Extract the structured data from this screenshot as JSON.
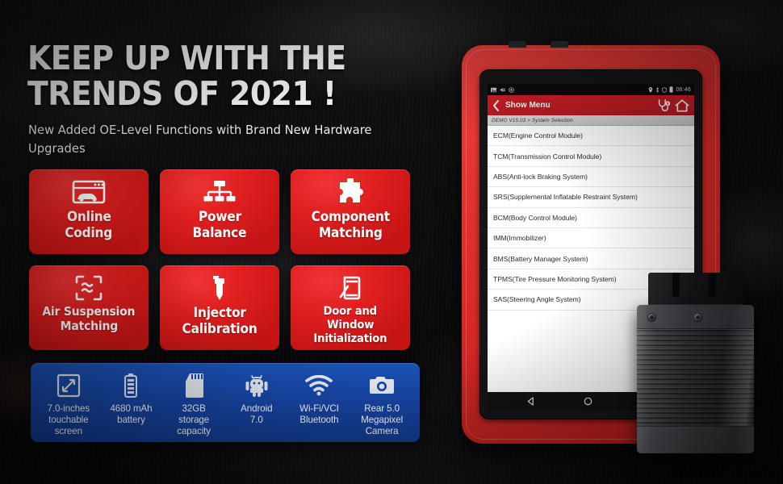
{
  "hero": {
    "headline_line1": "KEEP UP WITH THE",
    "headline_line2": "TRENDS OF 2021 !",
    "subheadline": "New Added OE-Level Functions with Brand New Hardware Upgrades"
  },
  "colors": {
    "tile_red": "#e01f1f",
    "spec_blue": "#1746a6",
    "bezel_red": "#e22a26",
    "app_header_red": "#cf2027"
  },
  "features": [
    {
      "label_line1": "Online",
      "label_line2": "Coding",
      "icon": "browser-car-icon",
      "size": "normal"
    },
    {
      "label_line1": "Power",
      "label_line2": "Balance",
      "icon": "node-tree-icon",
      "size": "normal"
    },
    {
      "label_line1": "Component",
      "label_line2": "Matching",
      "icon": "puzzle-piece-icon",
      "size": "normal"
    },
    {
      "label_line1": "Air Suspension",
      "label_line2": "Matching",
      "icon": "suspension-wave-icon",
      "size": "small"
    },
    {
      "label_line1": "Injector",
      "label_line2": "Calibration",
      "icon": "injector-icon",
      "size": "normal"
    },
    {
      "label_line1": "Door and",
      "label_line2": "Window",
      "label_line3": "Initialization",
      "icon": "door-window-icon",
      "size": "xsmall"
    }
  ],
  "specs": [
    {
      "icon": "screen-size-icon",
      "line1": "7.0-inches",
      "line2": "touchable",
      "line3": "screen"
    },
    {
      "icon": "battery-icon",
      "line1": "4680 mAh",
      "line2": "battery",
      "line3": ""
    },
    {
      "icon": "sd-card-icon",
      "line1": "32GB",
      "line2": "storage",
      "line3": "capacity"
    },
    {
      "icon": "android-icon",
      "line1": "Android",
      "line2": "7.0",
      "line3": ""
    },
    {
      "icon": "wifi-icon",
      "line1": "Wi-Fi/VCI",
      "line2": "Bluetooth",
      "line3": ""
    },
    {
      "icon": "camera-icon",
      "line1": "Rear 5.0",
      "line2": "Megapixel",
      "line3": "Camera"
    }
  ],
  "tablet": {
    "statusbar": {
      "time": "06:46",
      "left_icons": [
        "screenshot-icon",
        "mute-icon",
        "vibrate-icon"
      ],
      "right_icons": [
        "location-icon",
        "bluetooth-icon",
        "shield-icon",
        "battery-icon"
      ]
    },
    "app_header": {
      "back_icon": "chevron-left-icon",
      "title": "Show Menu",
      "right_icons": [
        "diagnostics-stethoscope-icon",
        "home-icon"
      ]
    },
    "breadcrumb": "DEMO V15.03 > System Selection",
    "system_list": [
      "ECM(Engine Control Module)",
      "TCM(Transmission Control Module)",
      "ABS(Anti-lock Braking System)",
      "SRS(Supplemental Inflatable Restraint System)",
      "BCM(Body Control Module)",
      "IMM(Immobilizer)",
      "BMS(Battery Manager System)",
      "TPMS(Tire Pressure Monitoring System)",
      "SAS(Steering Angle System)"
    ],
    "navbar": [
      "back-triangle-icon",
      "home-circle-icon",
      "recents-square-icon"
    ]
  }
}
